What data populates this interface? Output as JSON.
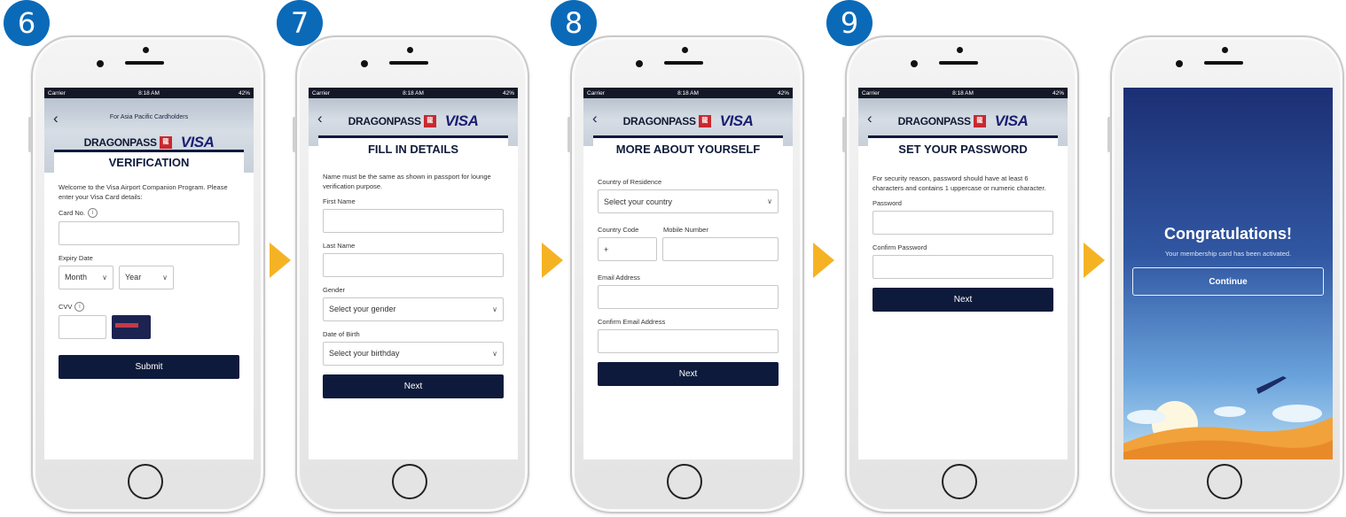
{
  "steps": [
    {
      "number": "6"
    },
    {
      "number": "7"
    },
    {
      "number": "8"
    },
    {
      "number": "9"
    }
  ],
  "status_bar": {
    "carrier": "Carrier",
    "time": "8:18 AM",
    "battery": "42%"
  },
  "brand": {
    "dragonpass": "DRAGONPASS",
    "dp_mark": "龍",
    "visa": "VISA"
  },
  "screen6": {
    "subtitle": "For Asia Pacific Cardholders",
    "title": "VERIFICATION",
    "description": "Welcome to the Visa Airport Companion Program. Please enter your Visa Card details:",
    "card_no_label": "Card No.",
    "expiry_label": "Expiry Date",
    "month": "Month",
    "year": "Year",
    "cvv_label": "CVV",
    "submit": "Submit"
  },
  "screen7": {
    "title": "FILL IN DETAILS",
    "description": "Name must be the same as shown in passport for lounge verification purpose.",
    "first_name": "First Name",
    "last_name": "Last Name",
    "gender_label": "Gender",
    "gender_placeholder": "Select your gender",
    "dob_label": "Date of Birth",
    "dob_placeholder": "Select your birthday",
    "next": "Next"
  },
  "screen8": {
    "title": "MORE ABOUT YOURSELF",
    "country_label": "Country of Residence",
    "country_placeholder": "Select your country",
    "code_label": "Country Code",
    "code_value": "+",
    "mobile_label": "Mobile Number",
    "email_label": "Email Address",
    "confirm_email_label": "Confirm Email Address",
    "next": "Next"
  },
  "screen9": {
    "title": "SET YOUR PASSWORD",
    "description": "For security reason, password should have at least 6 characters and contains 1 uppercase or numeric character.",
    "password_label": "Password",
    "confirm_label": "Confirm Password",
    "next": "Next"
  },
  "screen10": {
    "title": "Congratulations!",
    "message": "Your membership card has been activated.",
    "continue": "Continue"
  },
  "colors": {
    "navy": "#0d1a3b",
    "badge": "#0a6ab8",
    "arrow": "#f5b324",
    "visa": "#1a1f71"
  }
}
